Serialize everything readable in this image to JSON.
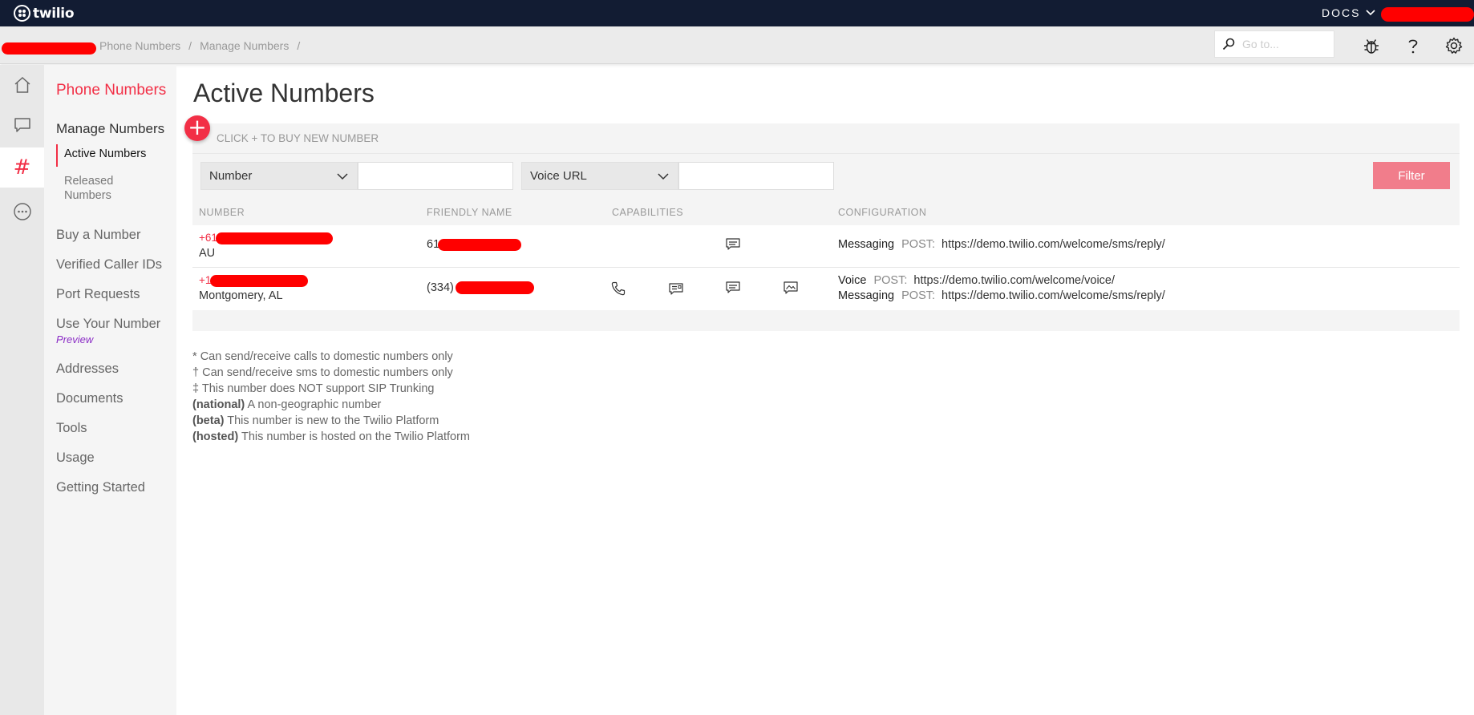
{
  "topbar": {
    "logo_text": "twilio",
    "docs_label": "DOCS"
  },
  "breadcrumb": {
    "items": [
      "Phone Numbers",
      "Manage Numbers"
    ],
    "separator": "/"
  },
  "search": {
    "placeholder": "Go to..."
  },
  "icons": {
    "top": [
      "bug-icon",
      "help-icon",
      "gear-icon"
    ],
    "rail": [
      "home-icon",
      "chat-icon",
      "hash-icon",
      "more-icon"
    ]
  },
  "sidebar": {
    "title": "Phone Numbers",
    "section": "Manage Numbers",
    "active_sub": "Active Numbers",
    "sub": "Released Numbers",
    "items": [
      "Buy a Number",
      "Verified Caller IDs",
      "Port Requests",
      "Use Your Number",
      "Addresses",
      "Documents",
      "Tools",
      "Usage",
      "Getting Started"
    ],
    "preview_badge": "Preview"
  },
  "main": {
    "title": "Active Numbers",
    "buy_label": "CLICK + TO BUY NEW NUMBER",
    "plus_label": "+",
    "filter": {
      "field1": "Number",
      "field2": "Voice URL",
      "button": "Filter"
    },
    "columns": [
      "NUMBER",
      "FRIENDLY NAME",
      "CAPABILITIES",
      "CONFIGURATION"
    ],
    "rows": [
      {
        "number_prefix": "+61",
        "location": "AU",
        "friendly_prefix": "61",
        "capabilities": [
          "sms-icon"
        ],
        "config": [
          {
            "type": "Messaging",
            "method": "POST:",
            "url": "https://demo.twilio.com/welcome/sms/reply/"
          }
        ]
      },
      {
        "number_prefix": "+1",
        "location": "Montgomery, AL",
        "friendly_prefix": "(334)",
        "capabilities": [
          "voice-icon",
          "fax-icon",
          "sms-icon",
          "mms-icon"
        ],
        "config": [
          {
            "type": "Voice",
            "method": "POST:",
            "url": "https://demo.twilio.com/welcome/voice/"
          },
          {
            "type": "Messaging",
            "method": "POST:",
            "url": "https://demo.twilio.com/welcome/sms/reply/"
          }
        ]
      }
    ],
    "notes": [
      {
        "mark": "*",
        "text": "Can send/receive calls to domestic numbers only"
      },
      {
        "mark": "†",
        "text": "Can send/receive sms to domestic numbers only"
      },
      {
        "mark": "‡",
        "text": "This number does NOT support SIP Trunking"
      },
      {
        "mark": "(national)",
        "text": "A non-geographic number"
      },
      {
        "mark": "(beta)",
        "text": "This number is new to the Twilio Platform"
      },
      {
        "mark": "(hosted)",
        "text": "This number is hosted on the Twilio Platform"
      }
    ]
  },
  "colors": {
    "brand_red": "#f22f46",
    "topbar_bg": "#121c33",
    "filter_button": "#f17d8b"
  }
}
